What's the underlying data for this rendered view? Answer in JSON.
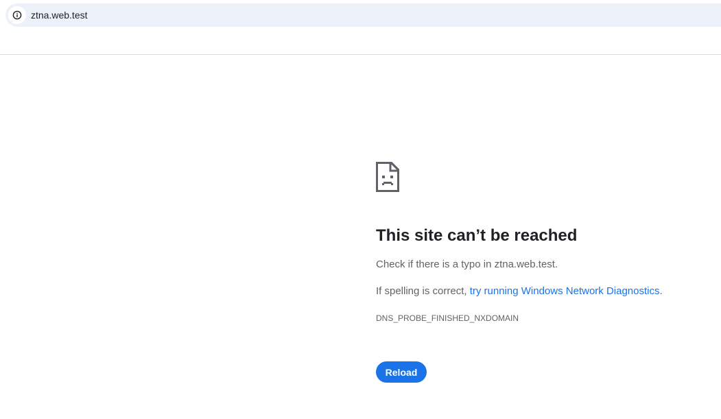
{
  "omnibox": {
    "url": "ztna.web.test",
    "icon": "info-icon"
  },
  "error": {
    "icon": "sad-page-icon",
    "heading": "This site can’t be reached",
    "check_text": "Check if there is a typo in ztna.web.test.",
    "spelling_prefix": "If spelling is correct, ",
    "diagnostics_link": "try running Windows Network Diagnostics",
    "spelling_suffix": ".",
    "code": "DNS_PROBE_FINISHED_NXDOMAIN",
    "reload_label": "Reload"
  },
  "colors": {
    "accent": "#1a73e8",
    "omnibox_bg": "#edf2fa",
    "heading": "#202124",
    "body_text": "#5f6368"
  }
}
